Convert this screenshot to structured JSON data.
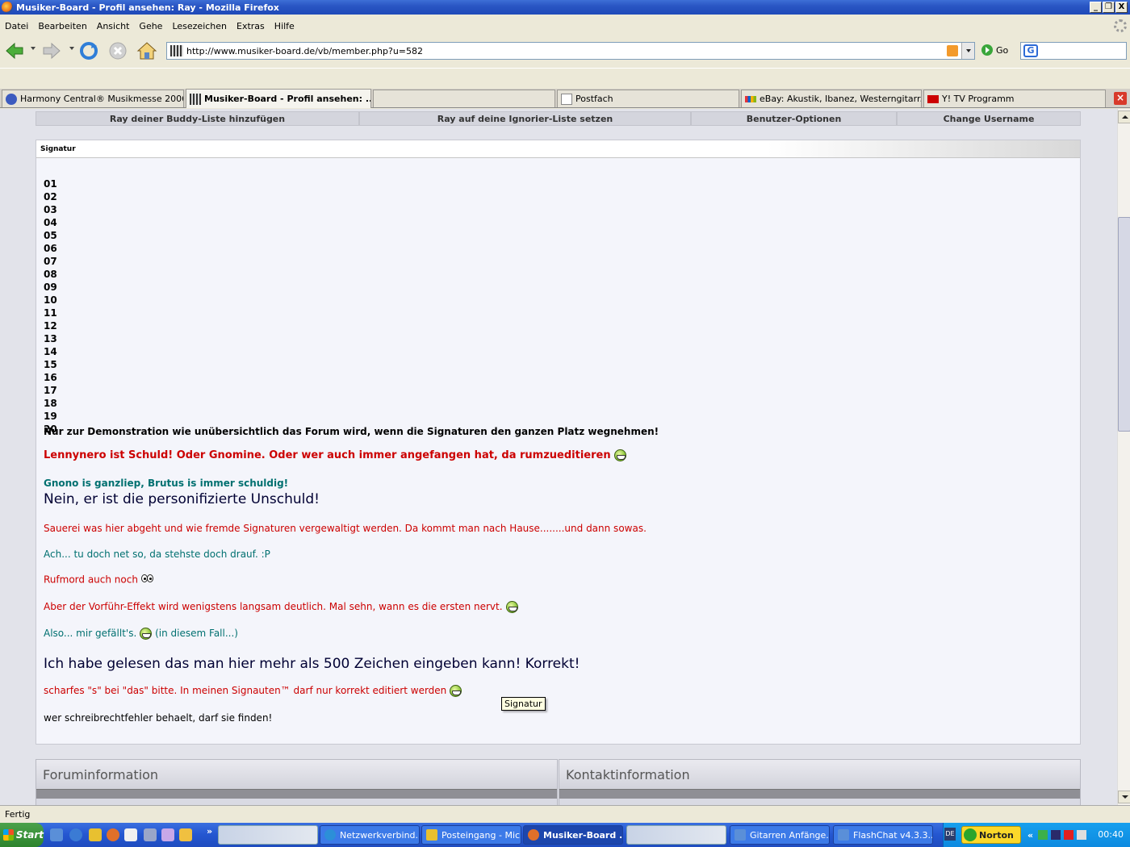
{
  "window": {
    "title": "Musiker-Board - Profil ansehen: Ray - Mozilla Firefox",
    "buttons": [
      "_",
      "❐",
      "X"
    ]
  },
  "menu": [
    "Datei",
    "Bearbeiten",
    "Ansicht",
    "Gehe",
    "Lesezeichen",
    "Extras",
    "Hilfe"
  ],
  "nav": {
    "url": "http://www.musiker-board.de/vb/member.php?u=582",
    "go_label": "Go",
    "search_logo": "G"
  },
  "tabs": [
    {
      "label": "Harmony Central® Musikmesse 2006 ...",
      "active": false,
      "icon": "harmony-central-icon"
    },
    {
      "label": "Musiker-Board - Profil ansehen: ...",
      "active": true,
      "icon": "musiker-board-icon"
    },
    {
      "label": "",
      "active": false,
      "icon": ""
    },
    {
      "label": "Postfach",
      "active": false,
      "icon": "page-icon"
    },
    {
      "label": "eBay: Akustik, Ibanez, Westerngitarr...",
      "active": false,
      "icon": "ebay-icon"
    },
    {
      "label": "Y! TV Programm",
      "active": false,
      "icon": "yahoo-icon"
    }
  ],
  "profile_options": [
    "Ray deiner Buddy-Liste hinzufügen",
    "Ray auf deine Ignorier-Liste setzen",
    "Benutzer-Optionen",
    "Change Username"
  ],
  "signature": {
    "heading": "Signatur",
    "numbers": [
      "01",
      "02",
      "03",
      "04",
      "05",
      "06",
      "07",
      "08",
      "09",
      "10",
      "11",
      "12",
      "13",
      "14",
      "15",
      "16",
      "17",
      "18",
      "19",
      "20"
    ],
    "lines": {
      "demo": "Nur zur Demonstration wie unübersichtlich das Forum wird, wenn die Signaturen den ganzen Platz wegnehmen!",
      "lennynero": "Lennynero ist Schuld! Oder Gnomine. Oder wer auch immer angefangen hat, da rumzueditieren",
      "gnono": "Gnono is ganzliep, Brutus is immer schuldig!",
      "unschuld": "Nein, er ist die personifizierte Unschuld!",
      "sauerei": "Sauerei was hier abgeht und wie fremde Signaturen vergewaltigt werden. Da kommt man nach Hause........und dann sowas.",
      "ach": "Ach... tu doch net so, da stehste doch drauf. :P",
      "rufmord": "Rufmord auch noch",
      "vorfuehr": "Aber der Vorführ-Effekt wird wenigstens langsam deutlich. Mal sehn, wann es die ersten nervt.",
      "also_a": "Also... mir gefällt's.",
      "also_b": "(in diesem Fall...)",
      "gelesen": "Ich habe gelesen das man hier mehr als 500 Zeichen eingeben kann! Korrekt!",
      "scharfes": "scharfes \"s\" bei \"das\" bitte. In meinen Signauten™ darf nur korrekt editiert werden",
      "schreib": "wer schreibrechtfehler behaelt, darf sie finden!"
    },
    "colors": {
      "red": "#cc0000",
      "teal": "#007070",
      "dark": "#000033"
    }
  },
  "tooltip": "Signatur",
  "info_panels": [
    "Foruminformation",
    "Kontaktinformation"
  ],
  "status": "Fertig",
  "taskbar": {
    "start": "Start",
    "items": [
      {
        "label": "",
        "blurred": true
      },
      {
        "label": "Netzwerkverbind...",
        "active": false
      },
      {
        "label": "Posteingang - Mic...",
        "active": false
      },
      {
        "label": "Musiker-Board ...",
        "active": true
      },
      {
        "label": "",
        "blurred": true
      },
      {
        "label": "Gitarren Anfänge...",
        "active": false
      },
      {
        "label": "FlashChat v4.3.3...",
        "active": false
      }
    ],
    "lang": "DE",
    "norton": "Norton",
    "chevron": "«",
    "clock": "00:40"
  }
}
